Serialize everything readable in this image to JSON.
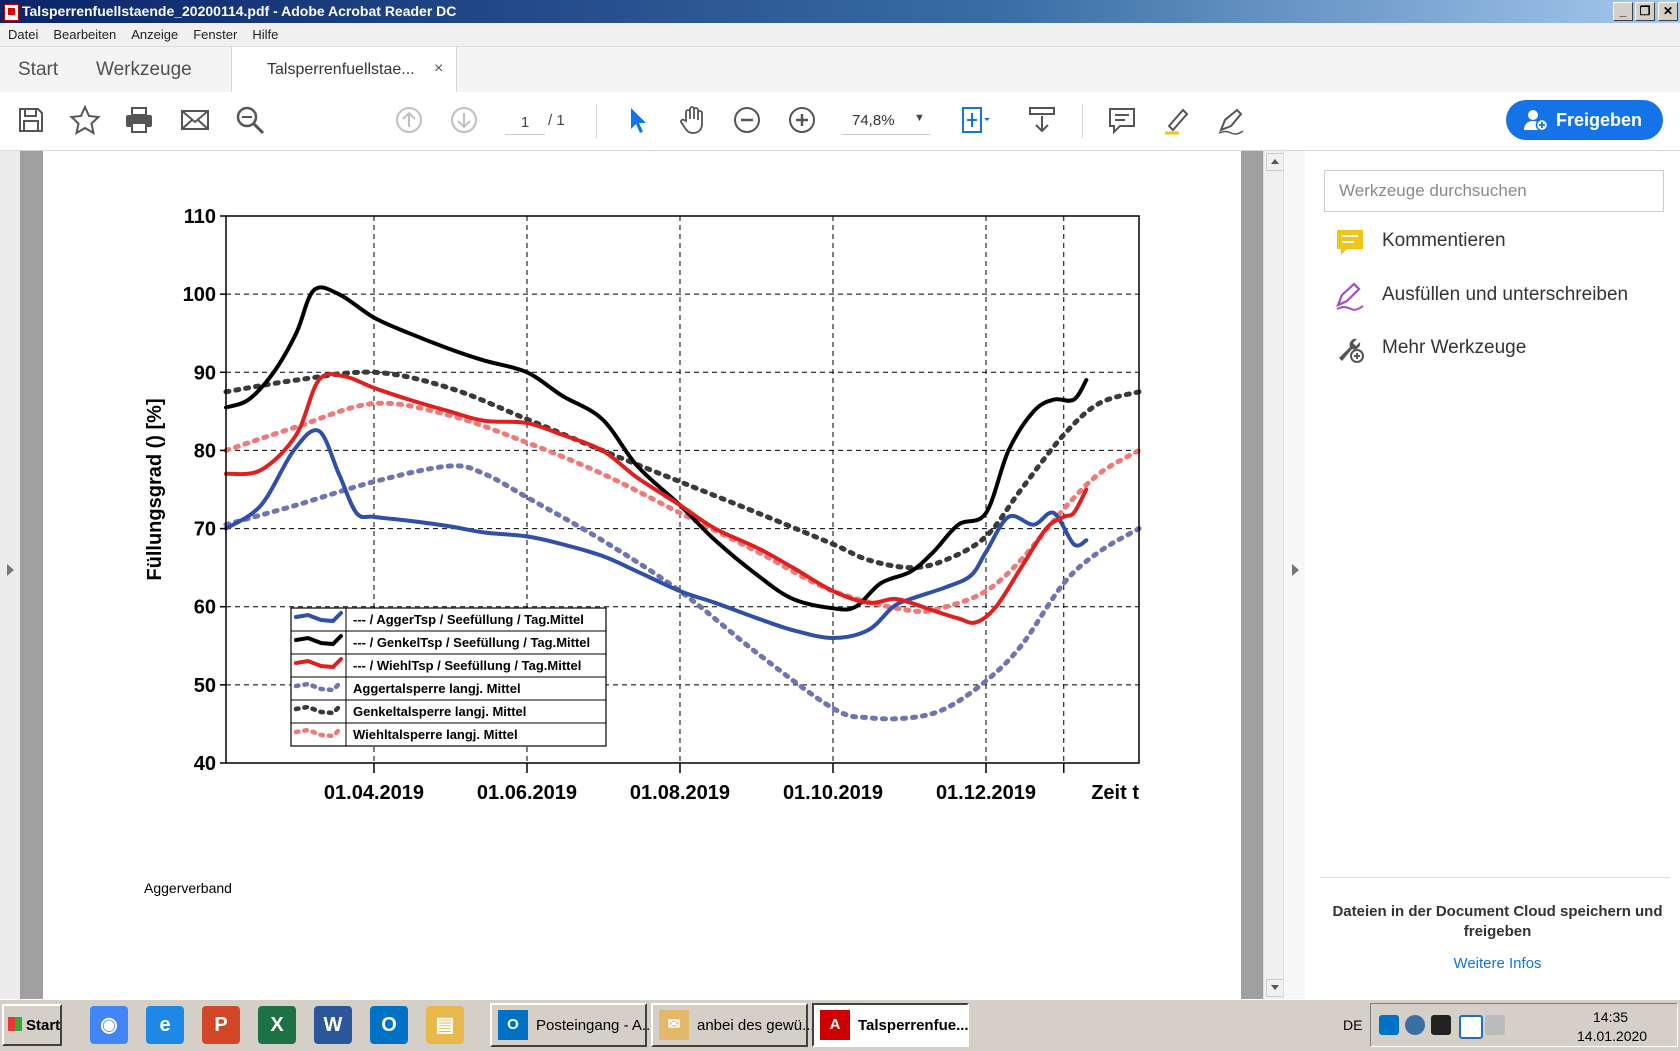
{
  "window": {
    "title": "Talsperrenfuellstaende_20200114.pdf - Adobe Acrobat Reader DC",
    "controls": [
      "_",
      "❐",
      "✕"
    ]
  },
  "menu": [
    "Datei",
    "Bearbeiten",
    "Anzeige",
    "Fenster",
    "Hilfe"
  ],
  "tabs": {
    "start": "Start",
    "tools": "Werkzeuge",
    "document": "Talsperrenfuellstae...",
    "close": "×"
  },
  "toolbar": {
    "page_current": "1",
    "page_total": "/ 1",
    "zoom": "74,8%",
    "share_label": "Freigeben",
    "accent": "#1473e6"
  },
  "panel": {
    "search_placeholder": "Werkzeuge durchsuchen",
    "items": [
      {
        "label": "Kommentieren",
        "icon": "comment-icon",
        "color": "#f0c419"
      },
      {
        "label": "Ausfüllen und unterschreiben",
        "icon": "fill-sign-icon",
        "color": "#9b4dca"
      },
      {
        "label": "Mehr Werkzeuge",
        "icon": "more-tools-icon",
        "color": "#555555"
      }
    ],
    "cloud_text": "Dateien in der Document Cloud speichern und freigeben",
    "cloud_link": "Weitere Infos"
  },
  "document": {
    "footer": "Aggerverband"
  },
  "chart_data": {
    "type": "line",
    "ylabel": "Füllungsgrad () [%]",
    "xlabel_end": "Zeit t",
    "ylim": [
      40,
      110
    ],
    "yticks": [
      40,
      50,
      60,
      70,
      80,
      90,
      100,
      110
    ],
    "xlim": [
      "2019-02-01",
      "2020-01-31"
    ],
    "xticks": [
      "01.04.2019",
      "01.06.2019",
      "01.08.2019",
      "01.10.2019",
      "01.12.2019"
    ],
    "grid": true,
    "legend_position": "bottom-left",
    "series": [
      {
        "name": "--- / AggerTsp / Seefüllung / Tag.Mittel",
        "color": "#2f4fa8",
        "style": "solid",
        "x": [
          "2019-02-01",
          "2019-02-15",
          "2019-02-28",
          "2019-03-10",
          "2019-03-18",
          "2019-03-25",
          "2019-04-01",
          "2019-04-15",
          "2019-05-01",
          "2019-05-15",
          "2019-06-01",
          "2019-06-15",
          "2019-07-01",
          "2019-07-15",
          "2019-08-01",
          "2019-08-15",
          "2019-09-01",
          "2019-09-15",
          "2019-10-01",
          "2019-10-15",
          "2019-10-25",
          "2019-11-01",
          "2019-11-15",
          "2019-11-25",
          "2019-12-01",
          "2019-12-10",
          "2019-12-20",
          "2019-12-28",
          "2020-01-05",
          "2020-01-10"
        ],
        "y": [
          70,
          73,
          80,
          82.5,
          77,
          72,
          71.5,
          71,
          70.3,
          69.5,
          69,
          68,
          66.5,
          64.5,
          62,
          60.5,
          58.5,
          57,
          56,
          57,
          60,
          61,
          62.5,
          64,
          67,
          71.5,
          70.5,
          72,
          68,
          68.5
        ]
      },
      {
        "name": "--- / GenkelTsp / Seefüllung / Tag.Mittel",
        "color": "#000000",
        "style": "solid",
        "x": [
          "2019-02-01",
          "2019-02-10",
          "2019-02-20",
          "2019-03-01",
          "2019-03-08",
          "2019-03-18",
          "2019-04-01",
          "2019-04-15",
          "2019-05-01",
          "2019-05-15",
          "2019-06-01",
          "2019-06-15",
          "2019-07-01",
          "2019-07-15",
          "2019-08-01",
          "2019-08-15",
          "2019-09-01",
          "2019-09-15",
          "2019-10-01",
          "2019-10-10",
          "2019-10-20",
          "2019-11-01",
          "2019-11-10",
          "2019-11-20",
          "2019-12-01",
          "2019-12-10",
          "2019-12-20",
          "2019-12-28",
          "2020-01-05",
          "2020-01-10"
        ],
        "y": [
          85.5,
          86.5,
          90,
          95,
          100.5,
          100,
          97,
          95,
          93,
          91.5,
          90,
          87,
          84,
          78,
          73,
          68.5,
          64,
          61,
          59.8,
          60,
          63,
          64.5,
          67,
          70.5,
          72,
          80,
          85,
          86.5,
          86.5,
          89
        ]
      },
      {
        "name": "--- / WiehlTsp / Seefüllung / Tag.Mittel",
        "color": "#e02020",
        "style": "solid",
        "x": [
          "2019-02-01",
          "2019-02-15",
          "2019-03-01",
          "2019-03-10",
          "2019-03-20",
          "2019-04-01",
          "2019-04-15",
          "2019-05-01",
          "2019-05-15",
          "2019-06-01",
          "2019-06-15",
          "2019-07-01",
          "2019-07-15",
          "2019-08-01",
          "2019-08-15",
          "2019-09-01",
          "2019-09-15",
          "2019-10-01",
          "2019-10-15",
          "2019-10-25",
          "2019-11-01",
          "2019-11-10",
          "2019-11-20",
          "2019-11-27",
          "2019-12-05",
          "2019-12-15",
          "2019-12-25",
          "2020-01-01",
          "2020-01-05",
          "2020-01-10"
        ],
        "y": [
          77,
          77.5,
          82,
          89,
          89.5,
          88,
          86.5,
          85,
          83.8,
          83.5,
          82,
          80,
          76.5,
          73,
          70,
          67.5,
          65,
          62,
          60.5,
          61,
          60.5,
          59.5,
          58.5,
          58,
          60,
          65,
          70,
          71.5,
          72,
          75
        ]
      },
      {
        "name": "Aggertalsperre langj. Mittel",
        "color": "#6f74b3",
        "style": "dotted",
        "x": [
          "2019-02-01",
          "2019-03-01",
          "2019-04-01",
          "2019-05-01",
          "2019-05-15",
          "2019-06-01",
          "2019-07-01",
          "2019-08-01",
          "2019-09-01",
          "2019-10-01",
          "2019-10-15",
          "2019-11-01",
          "2019-11-15",
          "2019-12-01",
          "2019-12-15",
          "2020-01-01",
          "2020-01-15",
          "2020-01-31"
        ],
        "y": [
          70.5,
          73,
          76,
          78,
          77,
          74,
          68.5,
          62,
          54,
          47,
          45.8,
          45.8,
          47,
          50.5,
          55,
          63,
          67,
          70
        ]
      },
      {
        "name": "Genkeltalsperre langj. Mittel",
        "color": "#3a3a3a",
        "style": "dotted",
        "x": [
          "2019-02-01",
          "2019-03-01",
          "2019-04-01",
          "2019-05-01",
          "2019-06-01",
          "2019-07-01",
          "2019-08-01",
          "2019-09-01",
          "2019-10-01",
          "2019-10-15",
          "2019-11-01",
          "2019-11-15",
          "2019-12-01",
          "2019-12-15",
          "2020-01-01",
          "2020-01-15",
          "2020-01-31"
        ],
        "y": [
          87.5,
          89,
          90,
          88,
          84,
          80,
          76,
          72,
          68,
          66,
          65,
          66,
          69,
          75,
          82,
          86,
          87.5
        ]
      },
      {
        "name": "Wiehltalsperre langj. Mittel",
        "color": "#ef7a7a",
        "style": "dotted",
        "x": [
          "2019-02-01",
          "2019-03-01",
          "2019-04-01",
          "2019-05-01",
          "2019-06-01",
          "2019-07-01",
          "2019-08-01",
          "2019-09-01",
          "2019-10-01",
          "2019-11-01",
          "2019-11-15",
          "2019-12-01",
          "2019-12-15",
          "2020-01-01",
          "2020-01-15",
          "2020-01-31"
        ],
        "y": [
          80,
          83,
          86,
          84.5,
          81,
          77,
          72,
          67,
          62,
          59.5,
          60,
          62,
          66,
          72.5,
          77,
          80
        ]
      }
    ]
  },
  "taskbar": {
    "start": "Start",
    "quick": [
      {
        "icon": "chrome-icon",
        "color": "#4285f4",
        "glyph": "◉"
      },
      {
        "icon": "ie-icon",
        "color": "#1e88e5",
        "glyph": "e"
      },
      {
        "icon": "powerpoint-icon",
        "color": "#d24726",
        "glyph": "P"
      },
      {
        "icon": "excel-icon",
        "color": "#1e7145",
        "glyph": "X"
      },
      {
        "icon": "word-icon",
        "color": "#2b579a",
        "glyph": "W"
      },
      {
        "icon": "outlook-icon",
        "color": "#0072c6",
        "glyph": "O"
      },
      {
        "icon": "explorer-icon",
        "color": "#e8b84a",
        "glyph": "▤"
      }
    ],
    "tasks": [
      {
        "label": "Posteingang - A...",
        "icon": "outlook-icon",
        "color": "#0072c6",
        "glyph": "O"
      },
      {
        "label": "anbei des gewü...",
        "icon": "mail-icon",
        "color": "#e4b86a",
        "glyph": "✉"
      },
      {
        "label": "Talsperrenfue...",
        "icon": "pdf-icon",
        "color": "#d00000",
        "glyph": "A"
      }
    ],
    "lang": "DE",
    "time": "14:35",
    "date": "14.01.2020"
  }
}
